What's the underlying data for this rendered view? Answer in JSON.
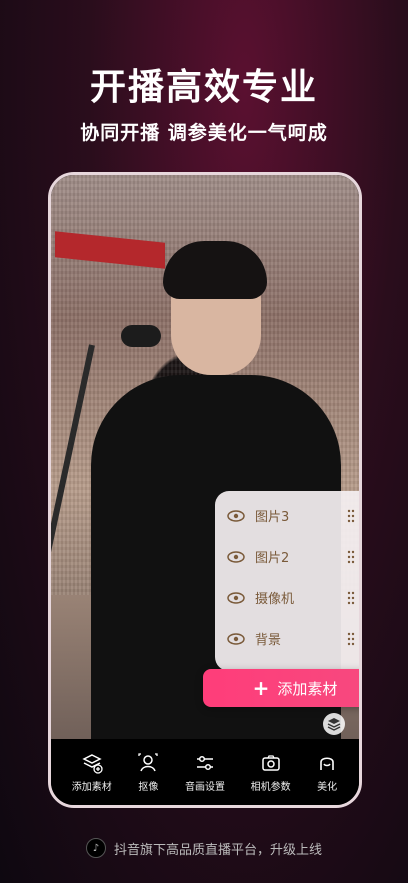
{
  "headline": "开播高效专业",
  "subline": "协同开播 调参美化一气呵成",
  "layers": [
    {
      "label": "图片3"
    },
    {
      "label": "图片2"
    },
    {
      "label": "摄像机"
    },
    {
      "label": "背景"
    }
  ],
  "add_button": {
    "label": "添加素材"
  },
  "toolbar": [
    {
      "label": "添加素材",
      "icon": "add-material-icon"
    },
    {
      "label": "抠像",
      "icon": "keying-icon"
    },
    {
      "label": "音画设置",
      "icon": "av-settings-icon"
    },
    {
      "label": "相机参数",
      "icon": "camera-params-icon"
    },
    {
      "label": "美化",
      "icon": "beauty-icon"
    }
  ],
  "footer": {
    "text": "抖音旗下高品质直播平台，升级上线"
  },
  "colors": {
    "accent": "#ff3d7a",
    "layer_text": "#7a5a3a"
  }
}
